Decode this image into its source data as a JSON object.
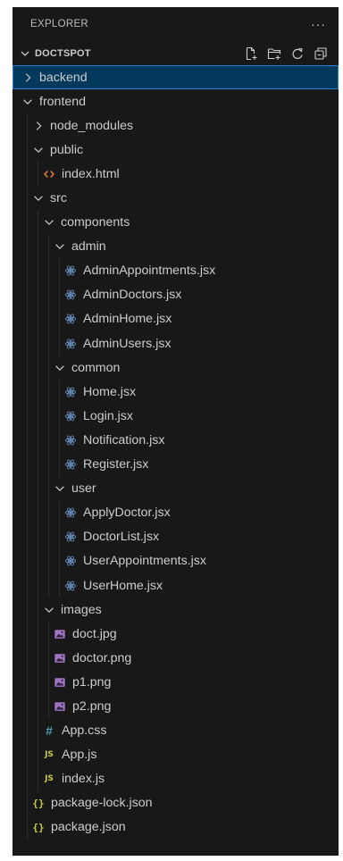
{
  "explorer": {
    "title": "EXPLORER",
    "more_label": "···"
  },
  "section": {
    "title": "DOCTSPOT",
    "actions": [
      "new-file-icon",
      "new-folder-icon",
      "refresh-icon",
      "collapse-all-icon"
    ]
  },
  "tree": [
    {
      "label": "backend",
      "depth": 0,
      "type": "folder",
      "expanded": false,
      "selected": true
    },
    {
      "label": "frontend",
      "depth": 0,
      "type": "folder",
      "expanded": true
    },
    {
      "label": "node_modules",
      "depth": 1,
      "type": "folder",
      "expanded": false
    },
    {
      "label": "public",
      "depth": 1,
      "type": "folder",
      "expanded": true
    },
    {
      "label": "index.html",
      "depth": 2,
      "type": "html"
    },
    {
      "label": "src",
      "depth": 1,
      "type": "folder",
      "expanded": true
    },
    {
      "label": "components",
      "depth": 2,
      "type": "folder",
      "expanded": true
    },
    {
      "label": "admin",
      "depth": 3,
      "type": "folder",
      "expanded": true
    },
    {
      "label": "AdminAppointments.jsx",
      "depth": 4,
      "type": "jsx"
    },
    {
      "label": "AdminDoctors.jsx",
      "depth": 4,
      "type": "jsx"
    },
    {
      "label": "AdminHome.jsx",
      "depth": 4,
      "type": "jsx"
    },
    {
      "label": "AdminUsers.jsx",
      "depth": 4,
      "type": "jsx"
    },
    {
      "label": "common",
      "depth": 3,
      "type": "folder",
      "expanded": true
    },
    {
      "label": "Home.jsx",
      "depth": 4,
      "type": "jsx"
    },
    {
      "label": "Login.jsx",
      "depth": 4,
      "type": "jsx"
    },
    {
      "label": "Notification.jsx",
      "depth": 4,
      "type": "jsx"
    },
    {
      "label": "Register.jsx",
      "depth": 4,
      "type": "jsx"
    },
    {
      "label": "user",
      "depth": 3,
      "type": "folder",
      "expanded": true
    },
    {
      "label": "ApplyDoctor.jsx",
      "depth": 4,
      "type": "jsx"
    },
    {
      "label": "DoctorList.jsx",
      "depth": 4,
      "type": "jsx"
    },
    {
      "label": "UserAppointments.jsx",
      "depth": 4,
      "type": "jsx"
    },
    {
      "label": "UserHome.jsx",
      "depth": 4,
      "type": "jsx"
    },
    {
      "label": "images",
      "depth": 2,
      "type": "folder",
      "expanded": true
    },
    {
      "label": "doct.jpg",
      "depth": 3,
      "type": "image"
    },
    {
      "label": "doctor.png",
      "depth": 3,
      "type": "image"
    },
    {
      "label": "p1.png",
      "depth": 3,
      "type": "image"
    },
    {
      "label": "p2.png",
      "depth": 3,
      "type": "image"
    },
    {
      "label": "App.css",
      "depth": 2,
      "type": "css",
      "icon_text": "#"
    },
    {
      "label": "App.js",
      "depth": 2,
      "type": "js",
      "icon_text": "JS"
    },
    {
      "label": "index.js",
      "depth": 2,
      "type": "js",
      "icon_text": "JS"
    },
    {
      "label": "package-lock.json",
      "depth": 1,
      "type": "json",
      "icon_text": "{}"
    },
    {
      "label": "package.json",
      "depth": 1,
      "type": "json",
      "icon_text": "{}"
    }
  ],
  "colors": {
    "panel_bg": "#181818",
    "selection_bg": "#04395e",
    "selection_border": "#1f7fd1",
    "text": "#cccccc",
    "react_icon": "#6a94c4",
    "html_icon": "#e37933",
    "image_icon": "#a074c4",
    "js_icon": "#cbcb41",
    "css_icon": "#519aba"
  }
}
